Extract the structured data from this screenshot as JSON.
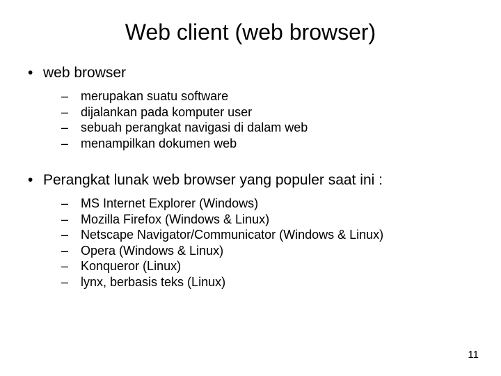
{
  "title": "Web client (web browser)",
  "sections": [
    {
      "heading": "web browser",
      "items": [
        "merupakan suatu software",
        "dijalankan pada komputer user",
        "sebuah perangkat navigasi di dalam web",
        "menampilkan dokumen web"
      ]
    },
    {
      "heading": "Perangkat lunak web browser yang populer saat ini :",
      "items": [
        "MS Internet Explorer (Windows)",
        "Mozilla Firefox (Windows & Linux)",
        "Netscape Navigator/Communicator (Windows & Linux)",
        "Opera (Windows & Linux)",
        "Konqueror (Linux)",
        "lynx, berbasis teks (Linux)"
      ]
    }
  ],
  "glyphs": {
    "bullet": "•",
    "dash": "–"
  },
  "page_number": "11"
}
